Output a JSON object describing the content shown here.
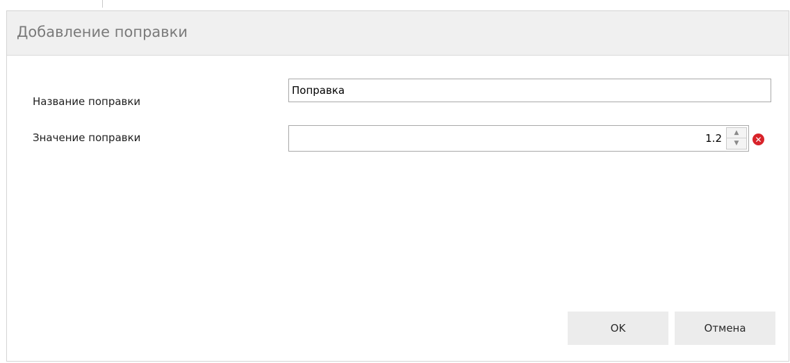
{
  "dialog": {
    "title": "Добавление поправки"
  },
  "form": {
    "name_label": "Название поправки",
    "name_value": "Поправка",
    "value_label": "Значение поправки",
    "value_value": "1.2"
  },
  "icons": {
    "spin_up": "chevron-up-icon",
    "spin_down": "chevron-down-icon",
    "validation": "error-icon"
  },
  "buttons": {
    "ok_label": "OK",
    "cancel_label": "Отмена"
  },
  "colors": {
    "error": "#d8232a",
    "titlebar_bg": "#f0f0f0",
    "button_bg": "#ececec"
  }
}
